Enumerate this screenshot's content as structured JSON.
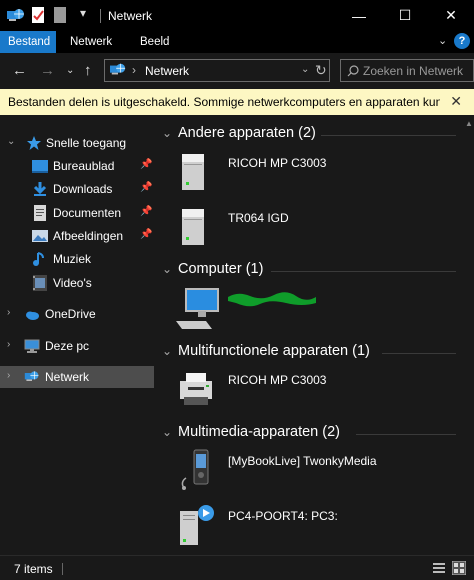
{
  "titlebar": {
    "title": "Netwerk",
    "minimize": "—",
    "maximize": "☐",
    "close": "✕"
  },
  "ribbon": {
    "tabs": [
      {
        "label": "Bestand",
        "active": true
      },
      {
        "label": "Netwerk",
        "active": false
      },
      {
        "label": "Beeld",
        "active": false
      }
    ],
    "expand": "⌄",
    "help": "?"
  },
  "address": {
    "location": "Netwerk",
    "search_placeholder": "Zoeken in Netwerk"
  },
  "infobar": {
    "message": "Bestanden delen is uitgeschakeld. Sommige netwerkcomputers en apparaten kun...",
    "close": "✕"
  },
  "navpane": {
    "quick_access": "Snelle toegang",
    "quick_items": [
      {
        "label": "Bureaublad",
        "icon": "desktop-icon",
        "pinned": true
      },
      {
        "label": "Downloads",
        "icon": "download-icon",
        "pinned": true
      },
      {
        "label": "Documenten",
        "icon": "document-icon",
        "pinned": true
      },
      {
        "label": "Afbeeldingen",
        "icon": "pictures-icon",
        "pinned": true
      },
      {
        "label": "Muziek",
        "icon": "music-icon",
        "pinned": false
      },
      {
        "label": "Video's",
        "icon": "video-icon",
        "pinned": false
      }
    ],
    "onedrive": "OneDrive",
    "this_pc": "Deze pc",
    "network": "Netwerk"
  },
  "content": {
    "groups": [
      {
        "title": "Andere apparaten (2)",
        "items": [
          {
            "label": "RICOH MP C3003",
            "icon": "device-icon"
          },
          {
            "label": "TR064 IGD",
            "icon": "device-icon"
          }
        ]
      },
      {
        "title": "Computer (1)",
        "items": [
          {
            "label": "",
            "icon": "computer-icon",
            "redacted": true
          }
        ]
      },
      {
        "title": "Multifunctionele apparaten (1)",
        "items": [
          {
            "label": "RICOH MP C3003",
            "icon": "printer-icon"
          }
        ]
      },
      {
        "title": "Multimedia-apparaten (2)",
        "items": [
          {
            "label": "[MyBookLive] TwonkyMedia",
            "icon": "media-player-icon"
          },
          {
            "label": "PC4-POORT4: PC3:",
            "icon": "media-server-icon"
          }
        ]
      }
    ]
  },
  "status": {
    "count": "7 items"
  },
  "colors": {
    "accent": "#1979ca",
    "infobar": "#fdf7c3",
    "redaction": "#0f9d2a"
  }
}
